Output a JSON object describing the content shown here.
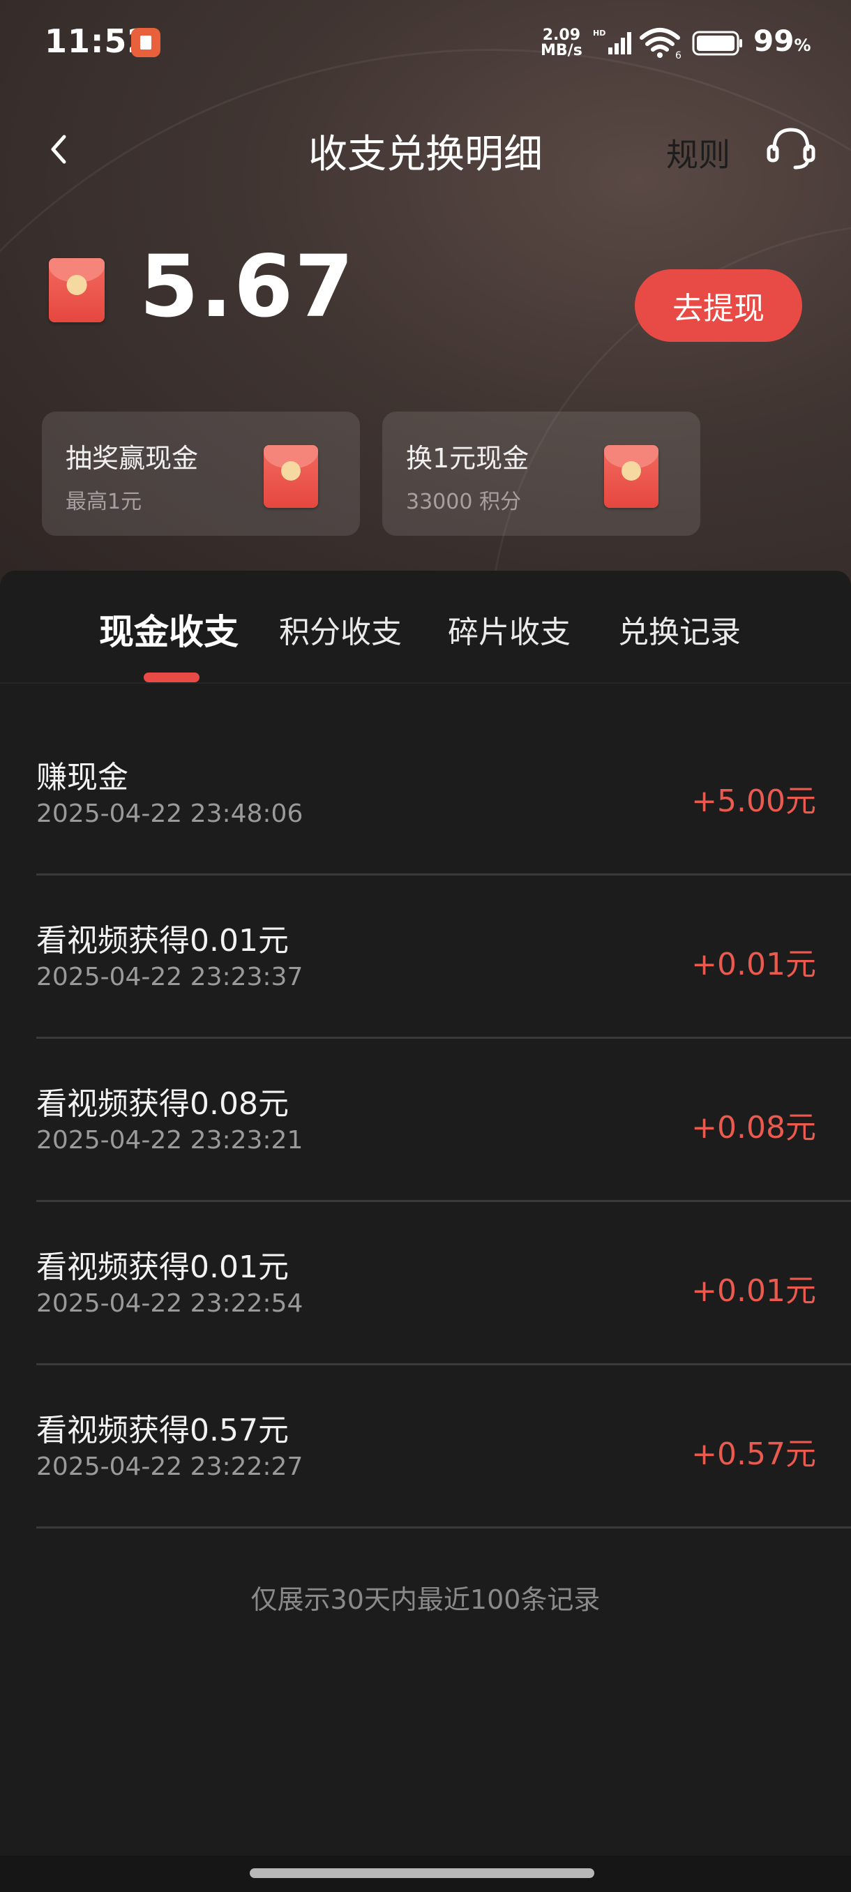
{
  "status_bar": {
    "time": "11:52",
    "speed_value": "2.09",
    "speed_unit": "MB/s",
    "battery_percent": "99",
    "battery_unit": "%"
  },
  "header": {
    "title": "收支兑换明细",
    "rules_label": "规则"
  },
  "balance": {
    "amount": "5.67",
    "withdraw_label": "去提现"
  },
  "promo_cards": [
    {
      "title": "抽奖赢现金",
      "subtitle": "最高1元"
    },
    {
      "title": "换1元现金",
      "subtitle": "33000 积分"
    }
  ],
  "tabs": [
    {
      "label": "现金收支",
      "active": true
    },
    {
      "label": "积分收支",
      "active": false
    },
    {
      "label": "碎片收支",
      "active": false
    },
    {
      "label": "兑换记录",
      "active": false
    }
  ],
  "records": [
    {
      "title": "赚现金",
      "date": "2025-04-22 23:48:06",
      "amount": "+5.00元"
    },
    {
      "title": "看视频获得0.01元",
      "date": "2025-04-22 23:23:37",
      "amount": "+0.01元"
    },
    {
      "title": "看视频获得0.08元",
      "date": "2025-04-22 23:23:21",
      "amount": "+0.08元"
    },
    {
      "title": "看视频获得0.01元",
      "date": "2025-04-22 23:22:54",
      "amount": "+0.01元"
    },
    {
      "title": "看视频获得0.57元",
      "date": "2025-04-22 23:22:27",
      "amount": "+0.57元"
    }
  ],
  "footer_note": "仅展示30天内最近100条记录",
  "colors": {
    "accent": "#e84b45",
    "amount_text": "#ea5a4f",
    "background": "#1c1c1c"
  }
}
